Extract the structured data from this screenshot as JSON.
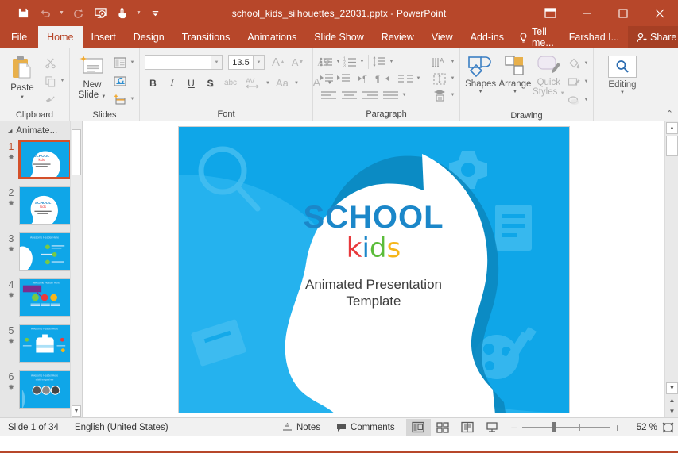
{
  "window": {
    "title": "school_kids_silhouettes_22031.pptx - PowerPoint",
    "accent_color": "#b7472a",
    "qat": [
      {
        "name": "save",
        "icon": "save-icon",
        "enabled": true
      },
      {
        "name": "undo",
        "icon": "undo-icon",
        "enabled": false
      },
      {
        "name": "redo",
        "icon": "redo-icon",
        "enabled": false
      },
      {
        "name": "start-slideshow",
        "icon": "slideshow-icon",
        "enabled": true
      },
      {
        "name": "touch-mouse-mode",
        "icon": "touch-mode-icon",
        "enabled": true
      },
      {
        "name": "customize-qat",
        "icon": "customize-icon",
        "enabled": true
      }
    ],
    "controls": [
      {
        "name": "ribbon-display-options",
        "glyph": "❐"
      },
      {
        "name": "minimize",
        "glyph": "–"
      },
      {
        "name": "maximize",
        "glyph": "□"
      },
      {
        "name": "close",
        "glyph": "✕"
      }
    ]
  },
  "ribbon": {
    "tabs": [
      {
        "label": "File",
        "active": false
      },
      {
        "label": "Home",
        "active": true
      },
      {
        "label": "Insert",
        "active": false
      },
      {
        "label": "Design",
        "active": false
      },
      {
        "label": "Transitions",
        "active": false
      },
      {
        "label": "Animations",
        "active": false
      },
      {
        "label": "Slide Show",
        "active": false
      },
      {
        "label": "Review",
        "active": false
      },
      {
        "label": "View",
        "active": false
      },
      {
        "label": "Add-ins",
        "active": false
      }
    ],
    "tell_me": "Tell me...",
    "account": "Farshad I...",
    "share": "Share",
    "groups": {
      "clipboard": {
        "label": "Clipboard",
        "paste": "Paste",
        "cut": "Cut",
        "copy": "Copy",
        "format_painter": "Format Painter"
      },
      "slides": {
        "label": "Slides",
        "new_slide_line1": "New",
        "new_slide_line2": "Slide",
        "layout": "Layout",
        "reset": "Reset",
        "section": "Section"
      },
      "font": {
        "label": "Font",
        "font_name_value": "",
        "font_name_placeholder": "",
        "font_size_value": "13.5",
        "bold": "B",
        "italic": "I",
        "underline": "U",
        "shadow": "S",
        "strikethrough": "abc",
        "char_spacing": "AV",
        "change_case": "Aa",
        "font_color": "A",
        "increase_size": "A",
        "decrease_size": "A"
      },
      "paragraph": {
        "label": "Paragraph"
      },
      "drawing": {
        "label": "Drawing",
        "shapes": "Shapes",
        "arrange": "Arrange",
        "quick_styles_line1": "Quick",
        "quick_styles_line2": "Styles",
        "shape_fill": "Shape Fill",
        "shape_outline": "Shape Outline",
        "shape_effects": "Shape Effects"
      },
      "editing": {
        "label": "Editing"
      }
    }
  },
  "slide_panel": {
    "section_name": "Animate...",
    "slides": [
      {
        "number": "1",
        "selected": true,
        "star": "✸",
        "variant": "title"
      },
      {
        "number": "2",
        "selected": false,
        "star": "✸",
        "variant": "title2"
      },
      {
        "number": "3",
        "selected": false,
        "star": "✸",
        "variant": "content",
        "header": "Awesome Header Here"
      },
      {
        "number": "4",
        "selected": false,
        "star": "✸",
        "variant": "icons",
        "header": "Awesome Header Here"
      },
      {
        "number": "5",
        "selected": false,
        "star": "✸",
        "variant": "bag",
        "header": "Awesome Header Here"
      },
      {
        "number": "6",
        "selected": false,
        "star": "✸",
        "variant": "people",
        "header": "Awesome Header Here"
      }
    ]
  },
  "slide": {
    "background_color": "#0fa6e8",
    "title_word": "SCHOOL",
    "title_color": "#1b87c9",
    "brand_letters": [
      {
        "char": "k",
        "color": "#e8393c"
      },
      {
        "char": "i",
        "color": "#1b87c9"
      },
      {
        "char": "d",
        "color": "#5bbc3a"
      },
      {
        "char": "s",
        "color": "#f5b61a"
      }
    ],
    "tagline_line1": "Animated Presentation",
    "tagline_line2": "Template"
  },
  "status_bar": {
    "slide_indicator": "Slide 1 of 34",
    "language": "English (United States)",
    "notes": "Notes",
    "comments": "Comments",
    "views": [
      {
        "name": "normal-view",
        "active": true
      },
      {
        "name": "slide-sorter-view",
        "active": false
      },
      {
        "name": "reading-view",
        "active": false
      },
      {
        "name": "slide-show-view",
        "active": false
      }
    ],
    "zoom_out": "−",
    "zoom_in": "+",
    "zoom_level": "52 %",
    "fit_to_window": "Fit slide to current window"
  }
}
